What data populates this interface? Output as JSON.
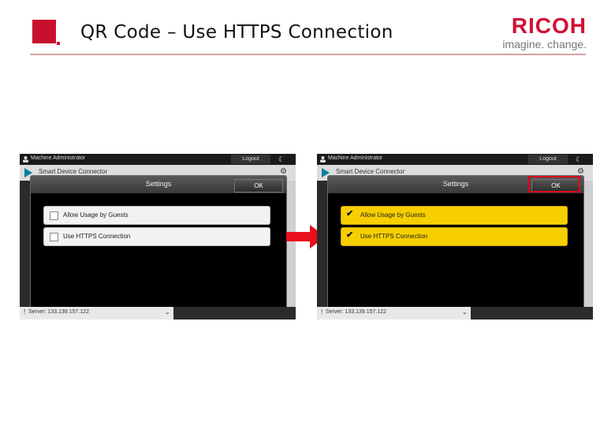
{
  "slide": {
    "title": "QR Code – Use HTTPS Connection",
    "brand_name": "RICOH",
    "brand_tagline": "imagine. change."
  },
  "screens": [
    {
      "admin_label": "Machine Administrator",
      "logout_label": "Logout",
      "app_name": "Smart Device Connector",
      "dialog_title": "Settings",
      "ok_label": "OK",
      "options": [
        {
          "label": "Allow Usage by Guests",
          "checked": false
        },
        {
          "label": "Use HTTPS Connection",
          "checked": false
        }
      ],
      "server_text": "Server: 133.139.157.122"
    },
    {
      "admin_label": "Machine Administrator",
      "logout_label": "Logout",
      "app_name": "Smart Device Connector",
      "dialog_title": "Settings",
      "ok_label": "OK",
      "options": [
        {
          "label": "Allow Usage by Guests",
          "checked": true
        },
        {
          "label": "Use HTTPS Connection",
          "checked": true
        }
      ],
      "server_text": "Server: 133.139.157.122"
    }
  ],
  "colors": {
    "brand_red": "#c8102e",
    "checked_row": "#f7cf00",
    "highlight_red": "#e0001a"
  }
}
